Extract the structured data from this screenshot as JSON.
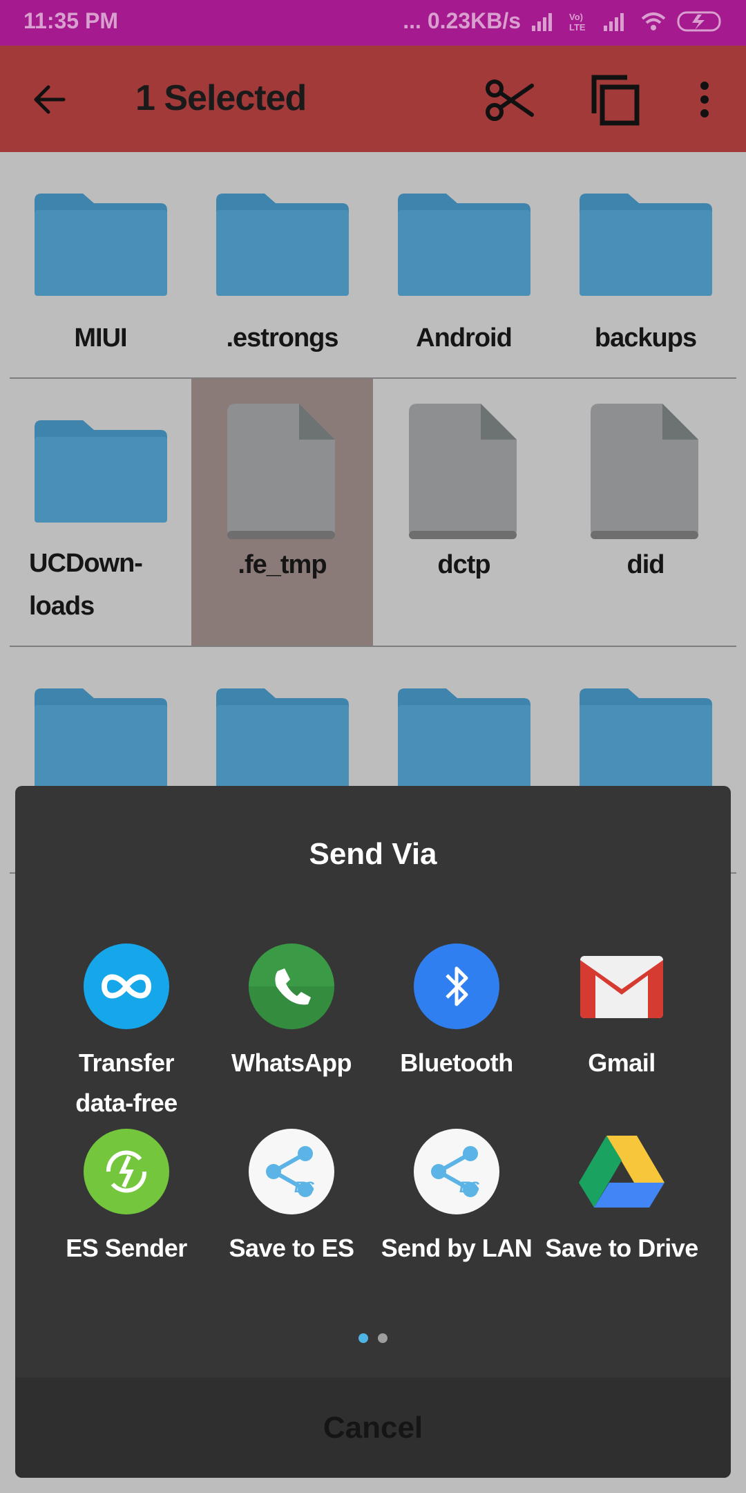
{
  "status_bar": {
    "time": "11:35 PM",
    "speed": "... 0.23KB/s"
  },
  "app_bar": {
    "title": "1 Selected"
  },
  "folders": {
    "row1": [
      "MIUI",
      ".estrongs",
      "Android",
      "backups"
    ],
    "row2": [
      "UCDown-\nloads",
      ".fe_tmp",
      "dctp",
      "did"
    ]
  },
  "dialog": {
    "title": "Send Via",
    "apps": [
      {
        "name": "Transfer\ndata-free",
        "icon": "transfer-icon"
      },
      {
        "name": "WhatsApp",
        "icon": "whatsapp-icon"
      },
      {
        "name": "Bluetooth",
        "icon": "bluetooth-icon"
      },
      {
        "name": "Gmail",
        "icon": "gmail-icon"
      },
      {
        "name": "ES Sender",
        "icon": "es-sender-icon"
      },
      {
        "name": "Save to ES",
        "icon": "save-to-es-icon"
      },
      {
        "name": "Send by LAN",
        "icon": "send-by-lan-icon"
      },
      {
        "name": "Save to Drive",
        "icon": "drive-icon"
      }
    ],
    "cancel": "Cancel"
  },
  "colors": {
    "status_bar": "#a51a8e",
    "app_bar": "#a23a3a",
    "folder": "#4a90b6",
    "selected_cell": "#8b7b78",
    "dialog": "#363636",
    "page_dot_active": "#4fb3e3",
    "page_dot_inactive": "#9e9e9e"
  }
}
